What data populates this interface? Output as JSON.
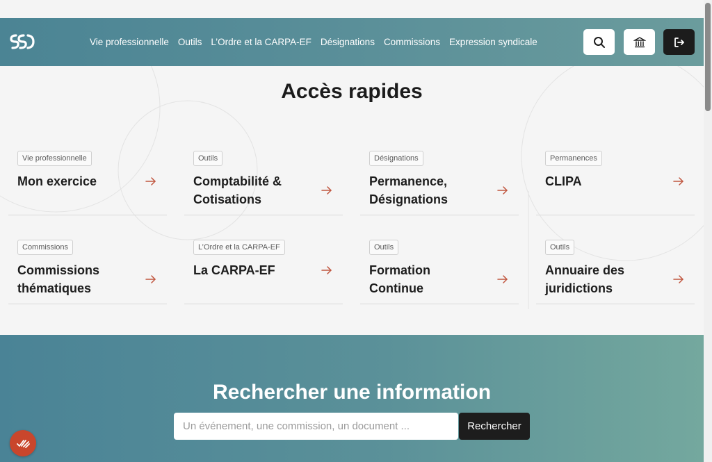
{
  "colors": {
    "header_gradient_start": "#4b8494",
    "header_gradient_end": "#6b9c9d",
    "accent_arrow": "#c0563f",
    "fab": "#c9462c",
    "dark_button": "#1c1c1c"
  },
  "header": {
    "logo_icon": "ssd-logo-icon",
    "nav": [
      "Vie professionnelle",
      "Outils",
      "L’Ordre et la CARPA-EF",
      "Désignations",
      "Commissions",
      "Expression syndicale"
    ],
    "buttons": [
      "search-icon",
      "courthouse-icon",
      "logout-icon"
    ]
  },
  "quick_access": {
    "title": "Accès rapides",
    "cards": [
      {
        "tag": "Vie professionnelle",
        "title": "Mon exercice"
      },
      {
        "tag": "Outils",
        "title": "Comptabilité & Cotisations"
      },
      {
        "tag": "Désignations",
        "title": "Permanence, Désignations"
      },
      {
        "tag": "Permanences",
        "title": "CLIPA"
      },
      {
        "tag": "Commissions",
        "title": "Commissions thématiques"
      },
      {
        "tag": "L’Ordre et la CARPA-EF",
        "title": "La CARPA-EF"
      },
      {
        "tag": "Outils",
        "title": "Formation Continue"
      },
      {
        "tag": "Outils",
        "title": "Annuaire des juridictions"
      }
    ]
  },
  "search": {
    "title": "Rechercher une information",
    "placeholder": "Un événement, une commission, un document ...",
    "value": "",
    "button_label": "Rechercher"
  },
  "fab_icon": "checklist-icon"
}
